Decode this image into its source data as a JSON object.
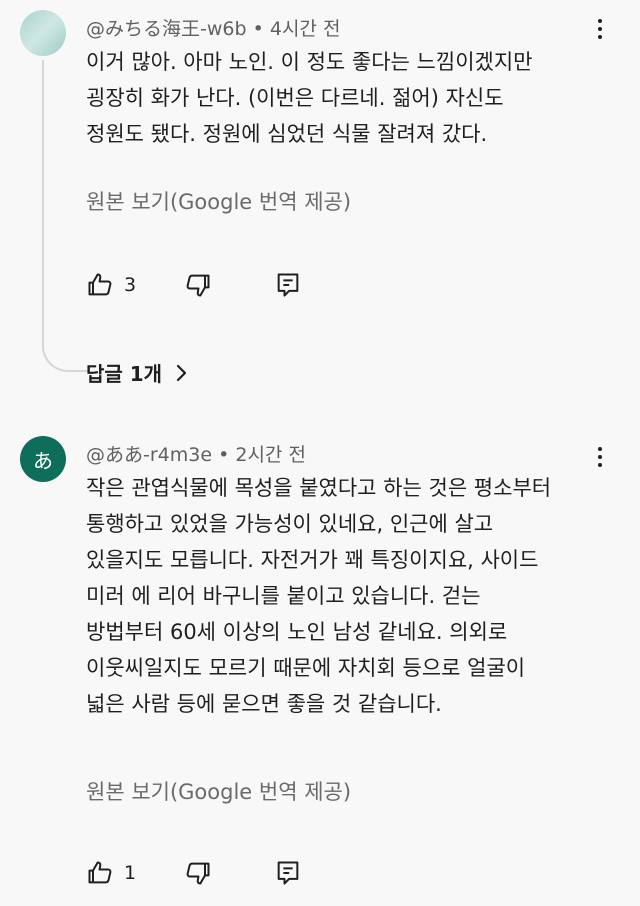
{
  "comments": [
    {
      "avatar_letter": "",
      "author": "@みちる海王-w6b",
      "separator": "•",
      "time": "4시간 전",
      "text": "이거 많아. 아마 노인. 이 정도 좋다는 느낌이겠지만\n굉장히 화가 난다. (이번은 다르네. 젊어) 자신도\n정원도 됐다. 정원에 심었던 식물 잘려져 갔다.",
      "translate_label": "원본 보기(Google 번역 제공)",
      "like_count": "3",
      "replies_label": "답글 1개"
    },
    {
      "avatar_letter": "あ",
      "author": "@ああ-r4m3e",
      "separator": "•",
      "time": "2시간 전",
      "text": "작은 관엽식물에 목성을 붙였다고 하는 것은 평소부터\n통행하고 있었을 가능성이 있네요, 인근에 살고\n있을지도 모릅니다. 자전거가 꽤 특징이지요, 사이드\n미러 에 리어 바구니를 붙이고 있습니다. 걷는\n방법부터 60세 이상의 노인 남성 같네요. 의외로\n이웃씨일지도 모르기 때문에 자치회 등으로 얼굴이\n넓은 사람 등에 묻으면 좋을 것 같습니다.",
      "translate_label": "원본 보기(Google 번역 제공)",
      "like_count": "1"
    }
  ],
  "icons": {
    "like": "thumbs-up-icon",
    "dislike": "thumbs-down-icon",
    "reply": "reply-comment-icon",
    "more": "more-vertical-icon",
    "chevron": "chevron-right-icon"
  },
  "colors": {
    "background": "#f8f8f8",
    "text": "#1f1f1f",
    "secondary_text": "#606060",
    "avatar_2": "#0f6e5b"
  }
}
